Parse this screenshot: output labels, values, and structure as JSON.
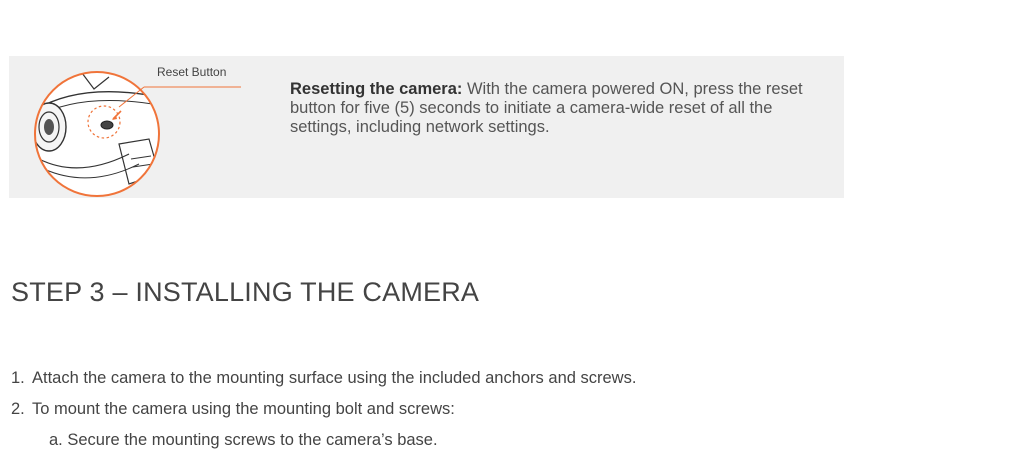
{
  "callout": {
    "label": "Reset Button",
    "heading": "Resetting the camera:",
    "body": " With the camera powered ON, press the reset button for five (5) seconds to  initiate a camera-wide reset of all the settings, including network settings."
  },
  "section": {
    "title": "STEP 3 – INSTALLING THE CAMERA",
    "steps": [
      {
        "number": "1.",
        "text": "Attach the camera to the mounting surface using the included anchors and screws."
      },
      {
        "number": "2.",
        "text": "To mount the camera using the mounting bolt and screws:"
      }
    ],
    "substeps": [
      {
        "text": "a. Secure the mounting screws to the camera’s base."
      }
    ]
  },
  "colors": {
    "accent": "#f0743a",
    "callout_bg": "#f0f0f0"
  }
}
